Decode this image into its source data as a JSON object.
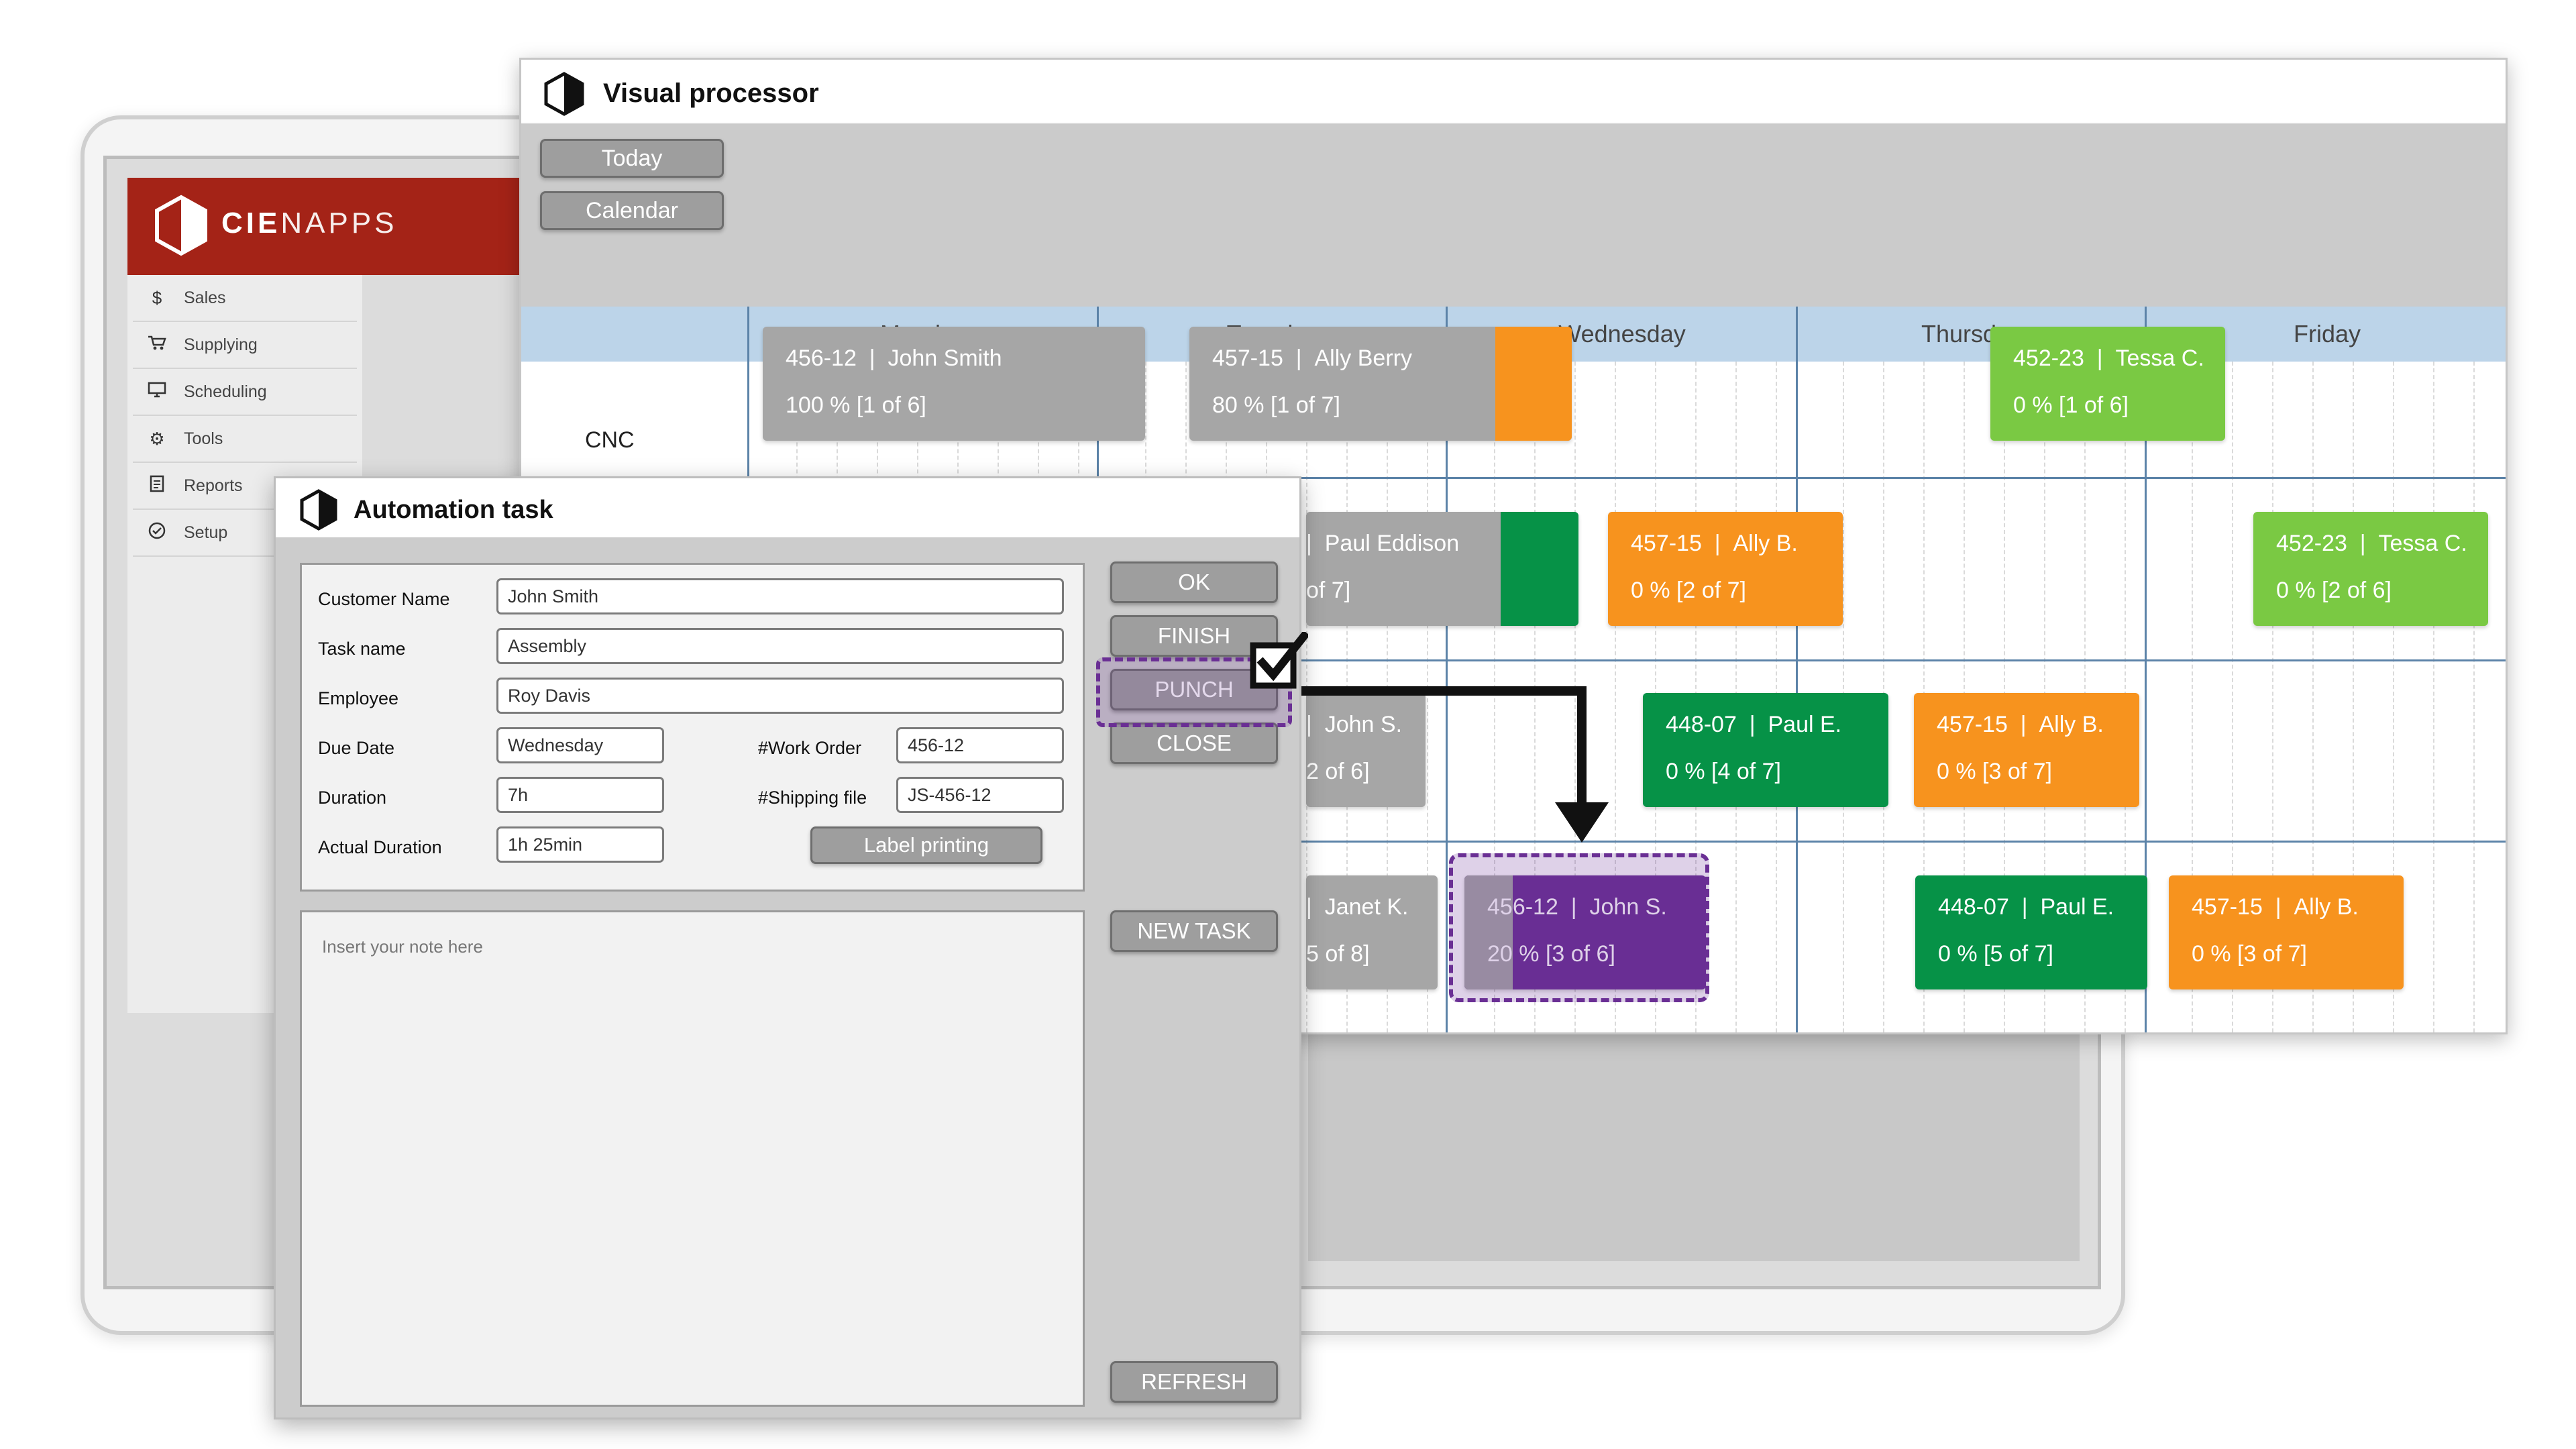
{
  "tablet": {
    "brand_bold": "CIE",
    "brand_rest": "NAPPS",
    "menu": [
      {
        "label": "Sales",
        "icon": "dollar-icon"
      },
      {
        "label": "Supplying",
        "icon": "cart-icon"
      },
      {
        "label": "Scheduling",
        "icon": "monitor-icon"
      },
      {
        "label": "Tools",
        "icon": "gear-icon"
      },
      {
        "label": "Reports",
        "icon": "document-icon"
      },
      {
        "label": "Setup",
        "icon": "check-circle-icon"
      }
    ]
  },
  "visual_processor": {
    "title": "Visual processor",
    "buttons": {
      "today": "Today",
      "calendar": "Calendar"
    },
    "days": [
      "Monday",
      "Tuesday",
      "Wednesday",
      "Thursday",
      "Friday"
    ],
    "rows": [
      {
        "label": "CNC"
      }
    ],
    "tasks": [
      {
        "order": "456-12",
        "name": "John Smith",
        "progress": "100 % [1 of 6]",
        "color": "gray"
      },
      {
        "order": "457-15",
        "name": "Ally Berry",
        "progress": "80 % [1 of 7]",
        "color": "gray",
        "bar_color": "orange"
      },
      {
        "order": "452-23",
        "name": "Tessa C.",
        "progress": "0 % [1 of 6]",
        "color": "light-green"
      },
      {
        "name": "Paul Eddison",
        "progress": "of 7]",
        "color": "gray",
        "bar_color": "dark-green"
      },
      {
        "order": "457-15",
        "name": "Ally B.",
        "progress": "0 % [2 of 7]",
        "color": "orange"
      },
      {
        "order": "452-23",
        "name": "Tessa C.",
        "progress": "0 % [2 of 6]",
        "color": "light-green"
      },
      {
        "name": "John S.",
        "progress": "2 of 6]",
        "color": "gray"
      },
      {
        "order": "448-07",
        "name": "Paul E.",
        "progress": "0 % [4 of 7]",
        "color": "dark-green"
      },
      {
        "order": "457-15",
        "name": "Ally B.",
        "progress": "0 % [3 of 7]",
        "color": "orange"
      },
      {
        "name": "Janet K.",
        "progress": "5 of 8]",
        "color": "gray"
      },
      {
        "order": "456-12",
        "name": "John S.",
        "progress": "20 % [3 of 6]",
        "color": "purple"
      },
      {
        "order": "448-07",
        "name": "Paul E.",
        "progress": "0 % [5 of 7]",
        "color": "dark-green"
      },
      {
        "order": "457-15",
        "name": "Ally B.",
        "progress": "0 % [3 of 7]",
        "color": "orange"
      }
    ]
  },
  "automation_task": {
    "title": "Automation task",
    "fields": {
      "customer_name": {
        "label": "Customer Name",
        "value": "John Smith"
      },
      "task_name": {
        "label": "Task name",
        "value": "Assembly"
      },
      "employee": {
        "label": "Employee",
        "value": "Roy Davis"
      },
      "due_date": {
        "label": "Due Date",
        "value": "Wednesday"
      },
      "work_order": {
        "label": "#Work Order",
        "value": "456-12"
      },
      "duration": {
        "label": "Duration",
        "value": "7h"
      },
      "shipping_file": {
        "label": "#Shipping file",
        "value": "JS-456-12"
      },
      "actual_duration": {
        "label": "Actual Duration",
        "value": "1h 25min"
      }
    },
    "label_printing": "Label printing",
    "note_placeholder": "Insert your note here",
    "buttons": {
      "ok": "OK",
      "finish": "FINISH",
      "punch": "PUNCH",
      "close": "CLOSE",
      "new_task": "NEW TASK",
      "refresh": "REFRESH"
    }
  },
  "colors": {
    "brand_red": "#a42317",
    "gray": "#a6a6a6",
    "orange": "#f7931e",
    "light-green": "#7ac943",
    "dark-green": "#069247",
    "purple": "#6a2f94",
    "header_blue": "#bcd4e9"
  }
}
